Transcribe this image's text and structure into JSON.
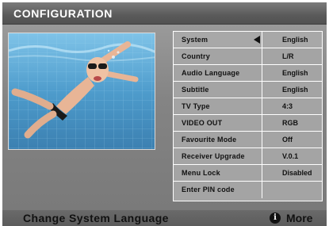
{
  "header": {
    "title": "CONFIGURATION"
  },
  "menu": {
    "rows": [
      {
        "label": "System",
        "value": "English",
        "selected": true
      },
      {
        "label": "Country",
        "value": "L/R"
      },
      {
        "label": "Audio Language",
        "value": "English"
      },
      {
        "label": "Subtitle",
        "value": "English"
      },
      {
        "label": "TV Type",
        "value": "4:3"
      },
      {
        "label": "VIDEO OUT",
        "value": "RGB"
      },
      {
        "label": "Favourite Mode",
        "value": "Off"
      },
      {
        "label": "Receiver Upgrade",
        "value": "V.0.1"
      },
      {
        "label": "Menu Lock",
        "value": "Disabled"
      },
      {
        "label": "Enter PIN code",
        "value": ""
      }
    ]
  },
  "footer": {
    "hint": "Change System Language",
    "info_glyph": "i",
    "more_label": "More"
  },
  "icons": {
    "info": "info-icon",
    "selector": "selector-arrow-icon"
  },
  "colors": {
    "panel": "#848484",
    "title_bar": "#5a5a5a",
    "grid_lines": "#ffffff"
  }
}
